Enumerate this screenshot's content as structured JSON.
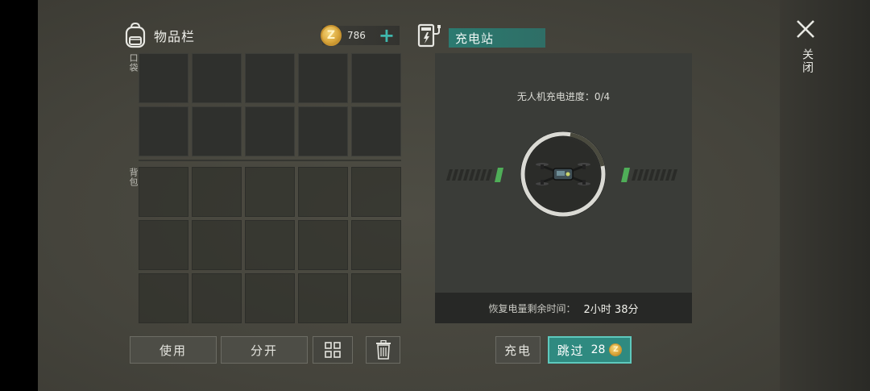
{
  "inventory": {
    "title": "物品栏",
    "coins": "786",
    "coin_symbol": "Z",
    "add_symbol": "+",
    "pocket_label": "口袋",
    "backpack_label": "背包",
    "pocket_slots": 10,
    "backpack_slots": 15,
    "use_label": "使用",
    "split_label": "分开",
    "icons": {
      "bag": "backpack-icon",
      "sort": "sort-icon",
      "trash": "trash-icon"
    }
  },
  "charging_station": {
    "title": "充电站",
    "progress_text": "无人机充电进度：0/4",
    "progress_current": 0,
    "progress_total": 4,
    "timer_label": "恢复电量剩余时间：",
    "timer_value": "2小时 38分",
    "charge_label": "充电",
    "skip_label": "跳过",
    "skip_cost": "28",
    "icons": {
      "station": "charging-station-icon",
      "drone": "drone-icon"
    }
  },
  "window": {
    "close_label": "关闭"
  },
  "colors": {
    "accent": "#2f8a80",
    "accent_border": "#5ec9bd",
    "plus": "#3fb7ad",
    "coin": "#d9a53a",
    "gauge_green": "#4fae58"
  }
}
